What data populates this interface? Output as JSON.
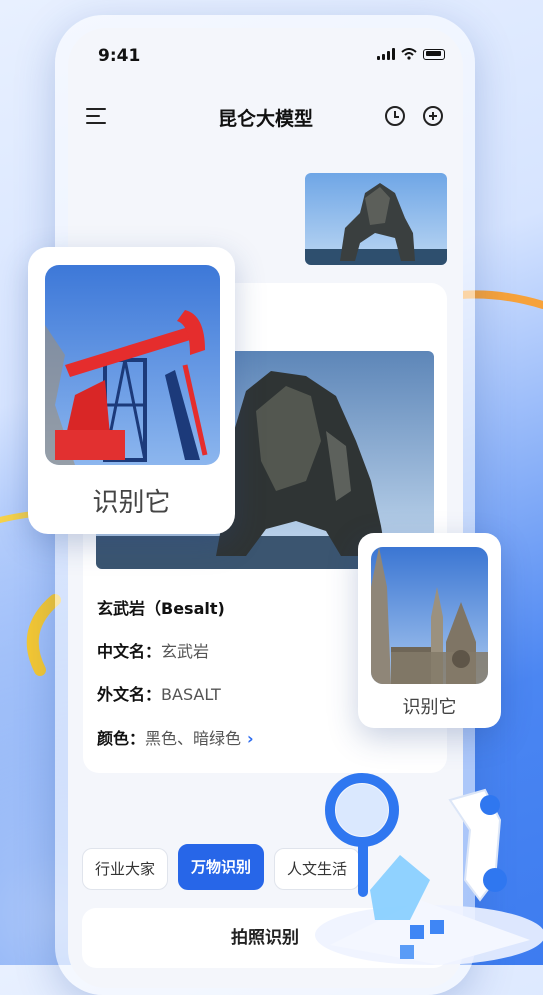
{
  "status_bar": {
    "time": "9:41"
  },
  "header": {
    "title": "昆仑大模型"
  },
  "result": {
    "title": "玄武岩（Besalt)",
    "chinese_name_label": "中文名：",
    "chinese_name_value": "玄武岩",
    "foreign_name_label": "外文名：",
    "foreign_name_value": "BASALT",
    "color_label": "颜色：",
    "color_value": "黑色、暗绿色"
  },
  "tabs": [
    {
      "label": "行业大家",
      "active": false
    },
    {
      "label": "万物识别",
      "active": true
    },
    {
      "label": "人文生活",
      "active": false
    }
  ],
  "photo_button": {
    "label": "拍照识别"
  },
  "floating_cards": {
    "big_label": "识别它",
    "small_label": "识别它"
  },
  "colors": {
    "accent": "#2766e8",
    "swoosh": "#f5b400",
    "orange": "#f7a23a"
  }
}
